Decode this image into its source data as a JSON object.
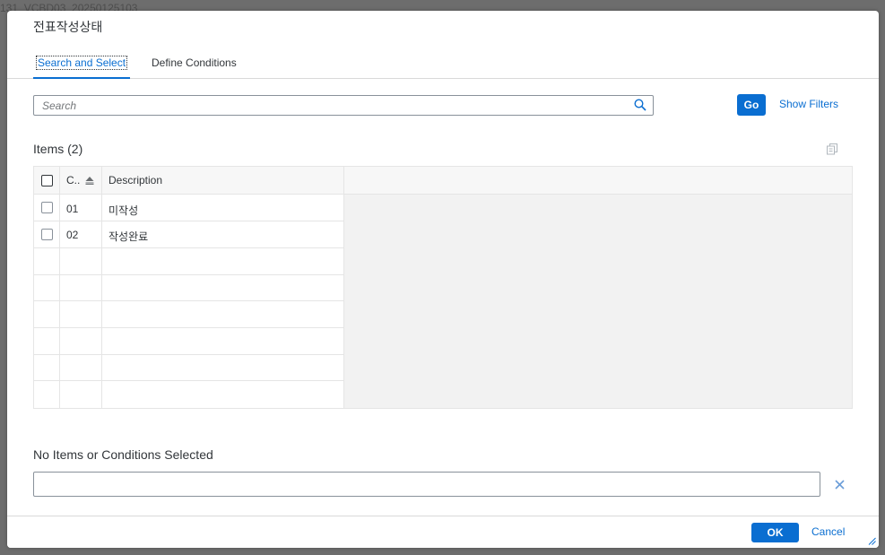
{
  "background": {
    "text": "131_VCBD03_20250125103"
  },
  "dialog": {
    "title": "전표작성상태",
    "tabs": [
      {
        "label": "Search and Select",
        "active": true
      },
      {
        "label": "Define Conditions",
        "active": false
      }
    ],
    "search": {
      "placeholder": "Search",
      "value": ""
    },
    "go_label": "Go",
    "show_filters_label": "Show Filters",
    "items_title": "Items (2)",
    "table": {
      "columns": [
        "C..",
        "Description"
      ],
      "rows": [
        {
          "code": "01",
          "description": "미작성"
        },
        {
          "code": "02",
          "description": "작성완료"
        }
      ]
    },
    "selection_summary": "No Items or Conditions Selected",
    "ok_label": "OK",
    "cancel_label": "Cancel"
  },
  "colors": {
    "accent": "#0a6ed1",
    "text": "#32363a",
    "border": "#89919a"
  }
}
